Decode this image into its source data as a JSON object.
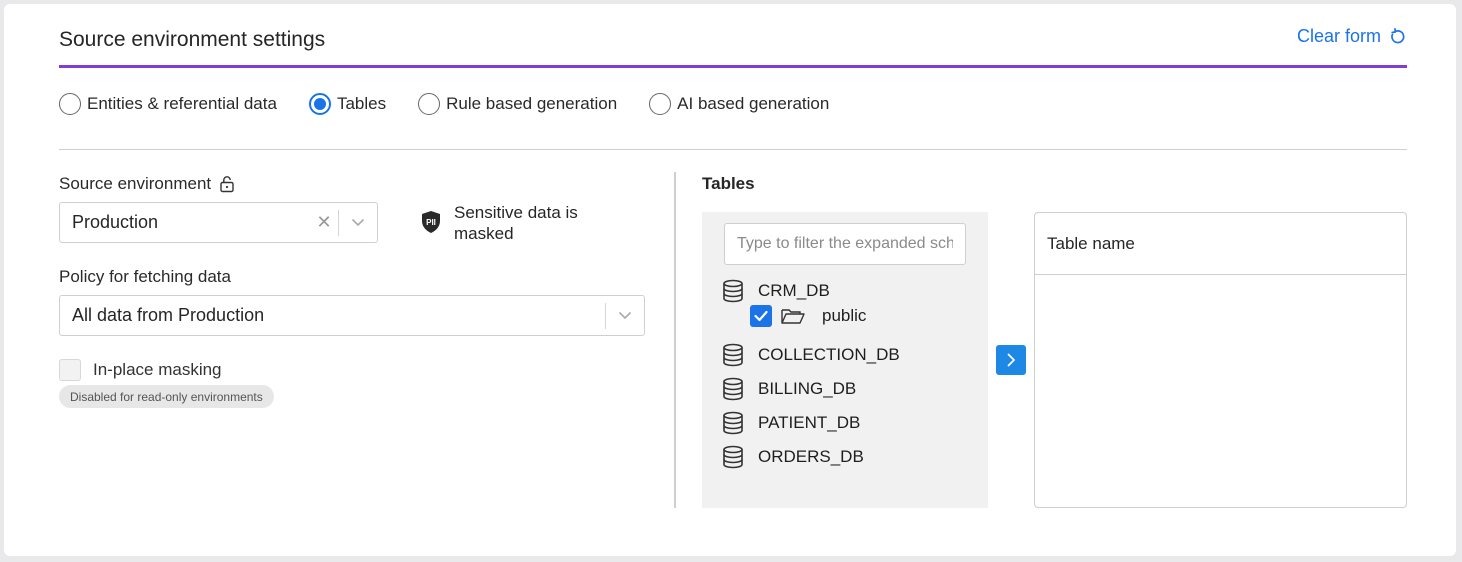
{
  "header": {
    "title": "Source environment settings",
    "clear_label": "Clear form"
  },
  "mode": {
    "options": [
      {
        "label": "Entities & referential data",
        "checked": false
      },
      {
        "label": "Tables",
        "checked": true
      },
      {
        "label": "Rule based generation",
        "checked": false
      },
      {
        "label": "AI based generation",
        "checked": false
      }
    ]
  },
  "source": {
    "label": "Source environment",
    "value": "Production",
    "pii_text": "Sensitive data is masked"
  },
  "policy": {
    "label": "Policy for fetching data",
    "value": "All data from Production"
  },
  "masking": {
    "label": "In-place masking",
    "checked": false,
    "badge": "Disabled for read-only environments"
  },
  "tables": {
    "title": "Tables",
    "filter_placeholder": "Type to filter the expanded schemas",
    "databases": [
      "CRM_DB",
      "COLLECTION_DB",
      "BILLING_DB",
      "PATIENT_DB",
      "ORDERS_DB"
    ],
    "schema": {
      "label": "public",
      "checked": true
    },
    "target_header": "Table name"
  },
  "colors": {
    "accent": "#1a73e8",
    "divider_purple": "#7e3fd8"
  },
  "icons": {
    "lock": "lock-icon",
    "pii": "pii-shield-icon",
    "database": "database-icon",
    "folder": "folder-open-icon",
    "refresh": "refresh-icon"
  }
}
